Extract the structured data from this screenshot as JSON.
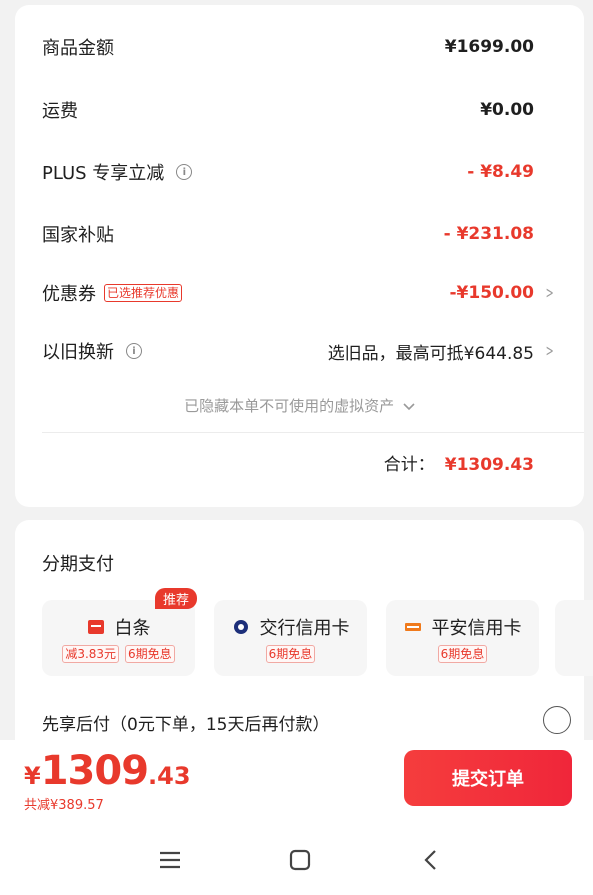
{
  "summary": {
    "rows": [
      {
        "label": "商品金额",
        "value": "¥1699.00"
      },
      {
        "label": "运费",
        "value": "¥0.00"
      },
      {
        "label": "PLUS 专享立减",
        "value": "- ¥8.49"
      },
      {
        "label": "国家补贴",
        "value": "- ¥231.08"
      },
      {
        "label": "优惠券",
        "tag": "已选推荐优惠",
        "value": "-¥150.00"
      },
      {
        "label": "以旧换新",
        "value": "选旧品，最高可抵¥644.85"
      }
    ],
    "hidden_assets": "已隐藏本单不可使用的虚拟资产",
    "total_label": "合计：",
    "total_value": "¥1309.43"
  },
  "installment": {
    "title": "分期支付",
    "options": [
      {
        "name": "白条",
        "badge": "推荐",
        "tags": [
          "减3.83元",
          "6期免息"
        ],
        "icon": "baitiao-icon"
      },
      {
        "name": "交行信用卡",
        "tags": [
          "6期免息"
        ],
        "icon": "bocom-icon"
      },
      {
        "name": "平安信用卡",
        "tags": [
          "6期免息"
        ],
        "icon": "pingan-icon"
      }
    ],
    "credit_pay": "先享后付（0元下单，15天后再付款）"
  },
  "bottom": {
    "currency": "¥",
    "price_int": "1309",
    "price_dec": ".43",
    "saved": "共减¥389.57",
    "submit": "提交订单"
  },
  "colors": {
    "accent": "#e8392c",
    "background": "#f2f2f2"
  }
}
